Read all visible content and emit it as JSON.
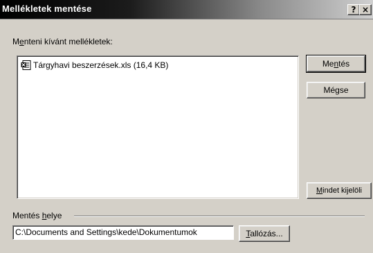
{
  "window": {
    "title": "Mellékletek mentése",
    "help_button": "?",
    "close_button": "×"
  },
  "attachments": {
    "label_pre": "M",
    "label_key": "e",
    "label_post": "nteni kívánt mellékletek:",
    "items": [
      {
        "name": "Tárgyhavi beszerzések.xls (16,4 KB)",
        "icon": "excel-file-icon"
      }
    ]
  },
  "buttons": {
    "save_pre": "Me",
    "save_key": "n",
    "save_post": "tés",
    "cancel": "Mégse",
    "select_all_key": "M",
    "select_all_post": "indet kijelöli",
    "browse_key": "T",
    "browse_post": "allózás..."
  },
  "location": {
    "label_pre": "Mentés ",
    "label_key": "h",
    "label_post": "elye",
    "path": "C:\\Documents and Settings\\kede\\Dokumentumok"
  }
}
